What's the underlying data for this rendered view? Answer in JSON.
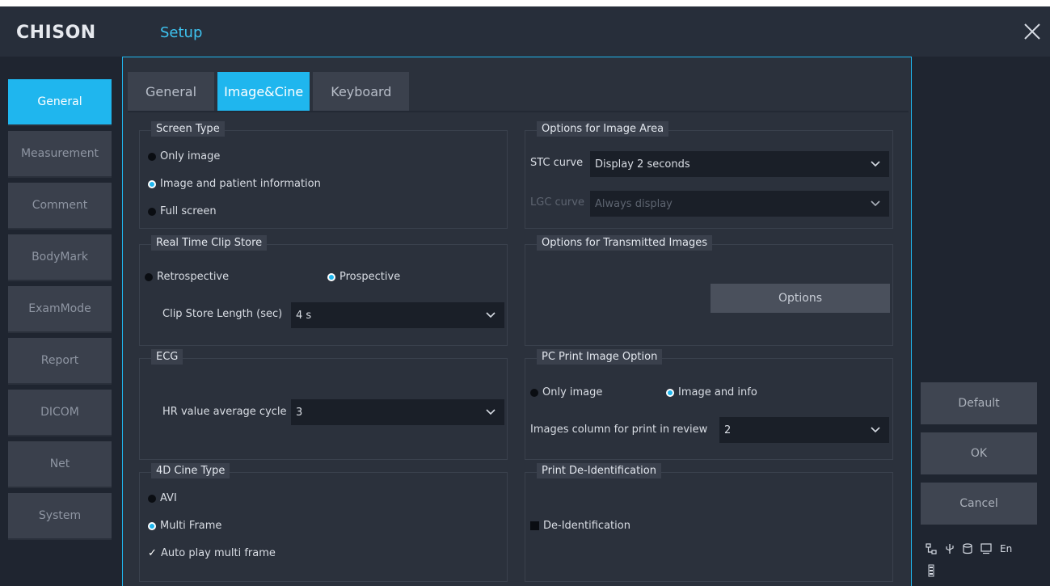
{
  "app": {
    "logo": "CHISON",
    "title": "Setup"
  },
  "sidebar": {
    "items": [
      {
        "label": "General"
      },
      {
        "label": "Measurement"
      },
      {
        "label": "Comment"
      },
      {
        "label": "BodyMark"
      },
      {
        "label": "ExamMode"
      },
      {
        "label": "Report"
      },
      {
        "label": "DICOM"
      },
      {
        "label": "Net"
      },
      {
        "label": "System"
      }
    ],
    "active": "General"
  },
  "tabs": [
    {
      "label": "General"
    },
    {
      "label": "Image&Cine"
    },
    {
      "label": "Keyboard"
    }
  ],
  "screen_type": {
    "title": "Screen Type",
    "options": [
      "Only image",
      "Image and patient information",
      "Full screen"
    ],
    "selected": "Image and patient information"
  },
  "clip_store": {
    "title": "Real Time Clip Store",
    "options": [
      "Retrospective",
      "Prospective"
    ],
    "selected": "Prospective",
    "length_label": "Clip Store Length (sec)",
    "length_value": "4 s"
  },
  "ecg": {
    "title": "ECG",
    "hr_label": "HR value average cycle",
    "hr_value": "3"
  },
  "cine_type": {
    "title": "4D Cine  Type",
    "options": [
      "AVI",
      "Multi Frame"
    ],
    "selected": "Multi Frame",
    "autoplay_label": "Auto play multi frame",
    "autoplay_checked": true
  },
  "image_area": {
    "title": "Options for Image Area",
    "stc_label": "STC curve",
    "stc_value": "Display 2 seconds",
    "lgc_label": "LGC curve",
    "lgc_value": "Always display"
  },
  "transmitted": {
    "title": "Options for Transmitted Images",
    "button": "Options"
  },
  "pc_print": {
    "title": "PC Print Image Option",
    "options": [
      "Only image",
      "Image and info"
    ],
    "selected": "Image and info",
    "columns_label": "Images column for print in review",
    "columns_value": "2"
  },
  "deid": {
    "title": "Print De-Identification",
    "checkbox_label": "De-Identification",
    "checked": false
  },
  "actions": {
    "default": "Default",
    "ok": "OK",
    "cancel": "Cancel"
  },
  "status_bar": {
    "icons": [
      "network-icon",
      "usb-icon",
      "storage-icon",
      "monitor-icon",
      "battery-icon"
    ],
    "language": "En"
  },
  "colors": {
    "accent": "#1fb6ee",
    "background": "#1f2530"
  }
}
